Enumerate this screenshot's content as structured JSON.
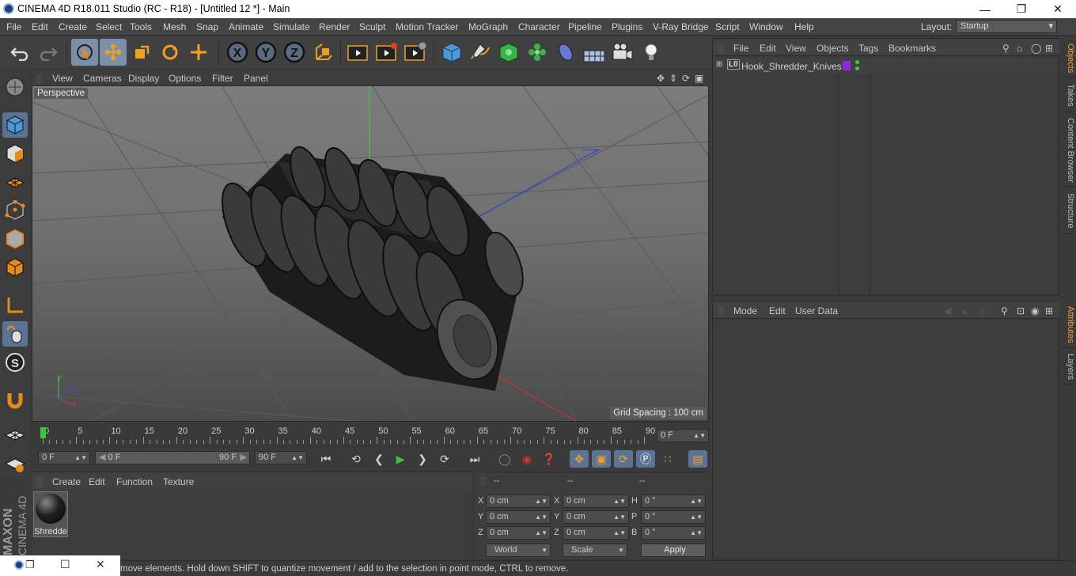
{
  "window": {
    "title": "CINEMA 4D R18.011 Studio (RC - R18) - [Untitled 12 *] - Main"
  },
  "menubar": {
    "items": [
      "File",
      "Edit",
      "Create",
      "Select",
      "Tools",
      "Mesh",
      "Snap",
      "Animate",
      "Simulate",
      "Render",
      "Sculpt",
      "Motion Tracker",
      "MoGraph",
      "Character",
      "Pipeline",
      "Plugins",
      "V-Ray Bridge",
      "Script",
      "Window",
      "Help"
    ],
    "layout_label": "Layout:",
    "layout_value": "Startup"
  },
  "toolbar": {
    "axis_x": "X",
    "axis_y": "Y",
    "axis_z": "Z"
  },
  "viewport": {
    "menu": [
      "View",
      "Cameras",
      "Display",
      "Options",
      "Filter",
      "Panel"
    ],
    "camera_label": "Perspective",
    "grid_spacing": "Grid Spacing : 100 cm",
    "axis_labels": {
      "x": "X",
      "y": "Y",
      "z": "Z"
    }
  },
  "timeline": {
    "ticks": [
      "0",
      "5",
      "10",
      "15",
      "20",
      "25",
      "30",
      "35",
      "40",
      "45",
      "50",
      "55",
      "60",
      "65",
      "70",
      "75",
      "80",
      "85",
      "90"
    ],
    "current_frame": "0 F"
  },
  "playbar": {
    "start_frame": "0 F",
    "range_start": "0 F",
    "range_end": "90 F",
    "end_frame": "90 F"
  },
  "materials": {
    "menu": [
      "Create",
      "Edit",
      "Function",
      "Texture"
    ],
    "items": [
      {
        "name": "Shredde"
      }
    ]
  },
  "coordinates": {
    "headers": [
      "--",
      "--",
      "--"
    ],
    "rows": [
      {
        "l1": "X",
        "v1": "0 cm",
        "l2": "X",
        "v2": "0 cm",
        "l3": "H",
        "v3": "0 °"
      },
      {
        "l1": "Y",
        "v1": "0 cm",
        "l2": "Y",
        "v2": "0 cm",
        "l3": "P",
        "v3": "0 °"
      },
      {
        "l1": "Z",
        "v1": "0 cm",
        "l2": "Z",
        "v2": "0 cm",
        "l3": "B",
        "v3": "0 °"
      }
    ],
    "mode_world": "World",
    "mode_scale": "Scale",
    "apply": "Apply"
  },
  "objects": {
    "menu": [
      "File",
      "Edit",
      "View",
      "Objects",
      "Tags",
      "Bookmarks"
    ],
    "items": [
      {
        "name": "Hook_Shredder_Knives",
        "layer_icon": "L0",
        "tag_color": "#8a2be2"
      }
    ]
  },
  "attributes": {
    "menu": [
      "Mode",
      "Edit",
      "User Data"
    ]
  },
  "right_tabs": {
    "top": [
      "Objects",
      "Takes",
      "Content Browser",
      "Structure"
    ],
    "bottom": [
      "Attributes",
      "Layers"
    ]
  },
  "branding": {
    "maxon": "MAXON",
    "product": "CINEMA 4D"
  },
  "status": {
    "text": "move elements. Hold down SHIFT to quantize movement / add to the selection in point mode, CTRL to remove."
  },
  "colors": {
    "accent": "#f2a13a",
    "selected_tool": "#7a8fa8",
    "axis_x": "#d03030",
    "axis_y": "#30c030",
    "axis_z": "#3040d0"
  }
}
